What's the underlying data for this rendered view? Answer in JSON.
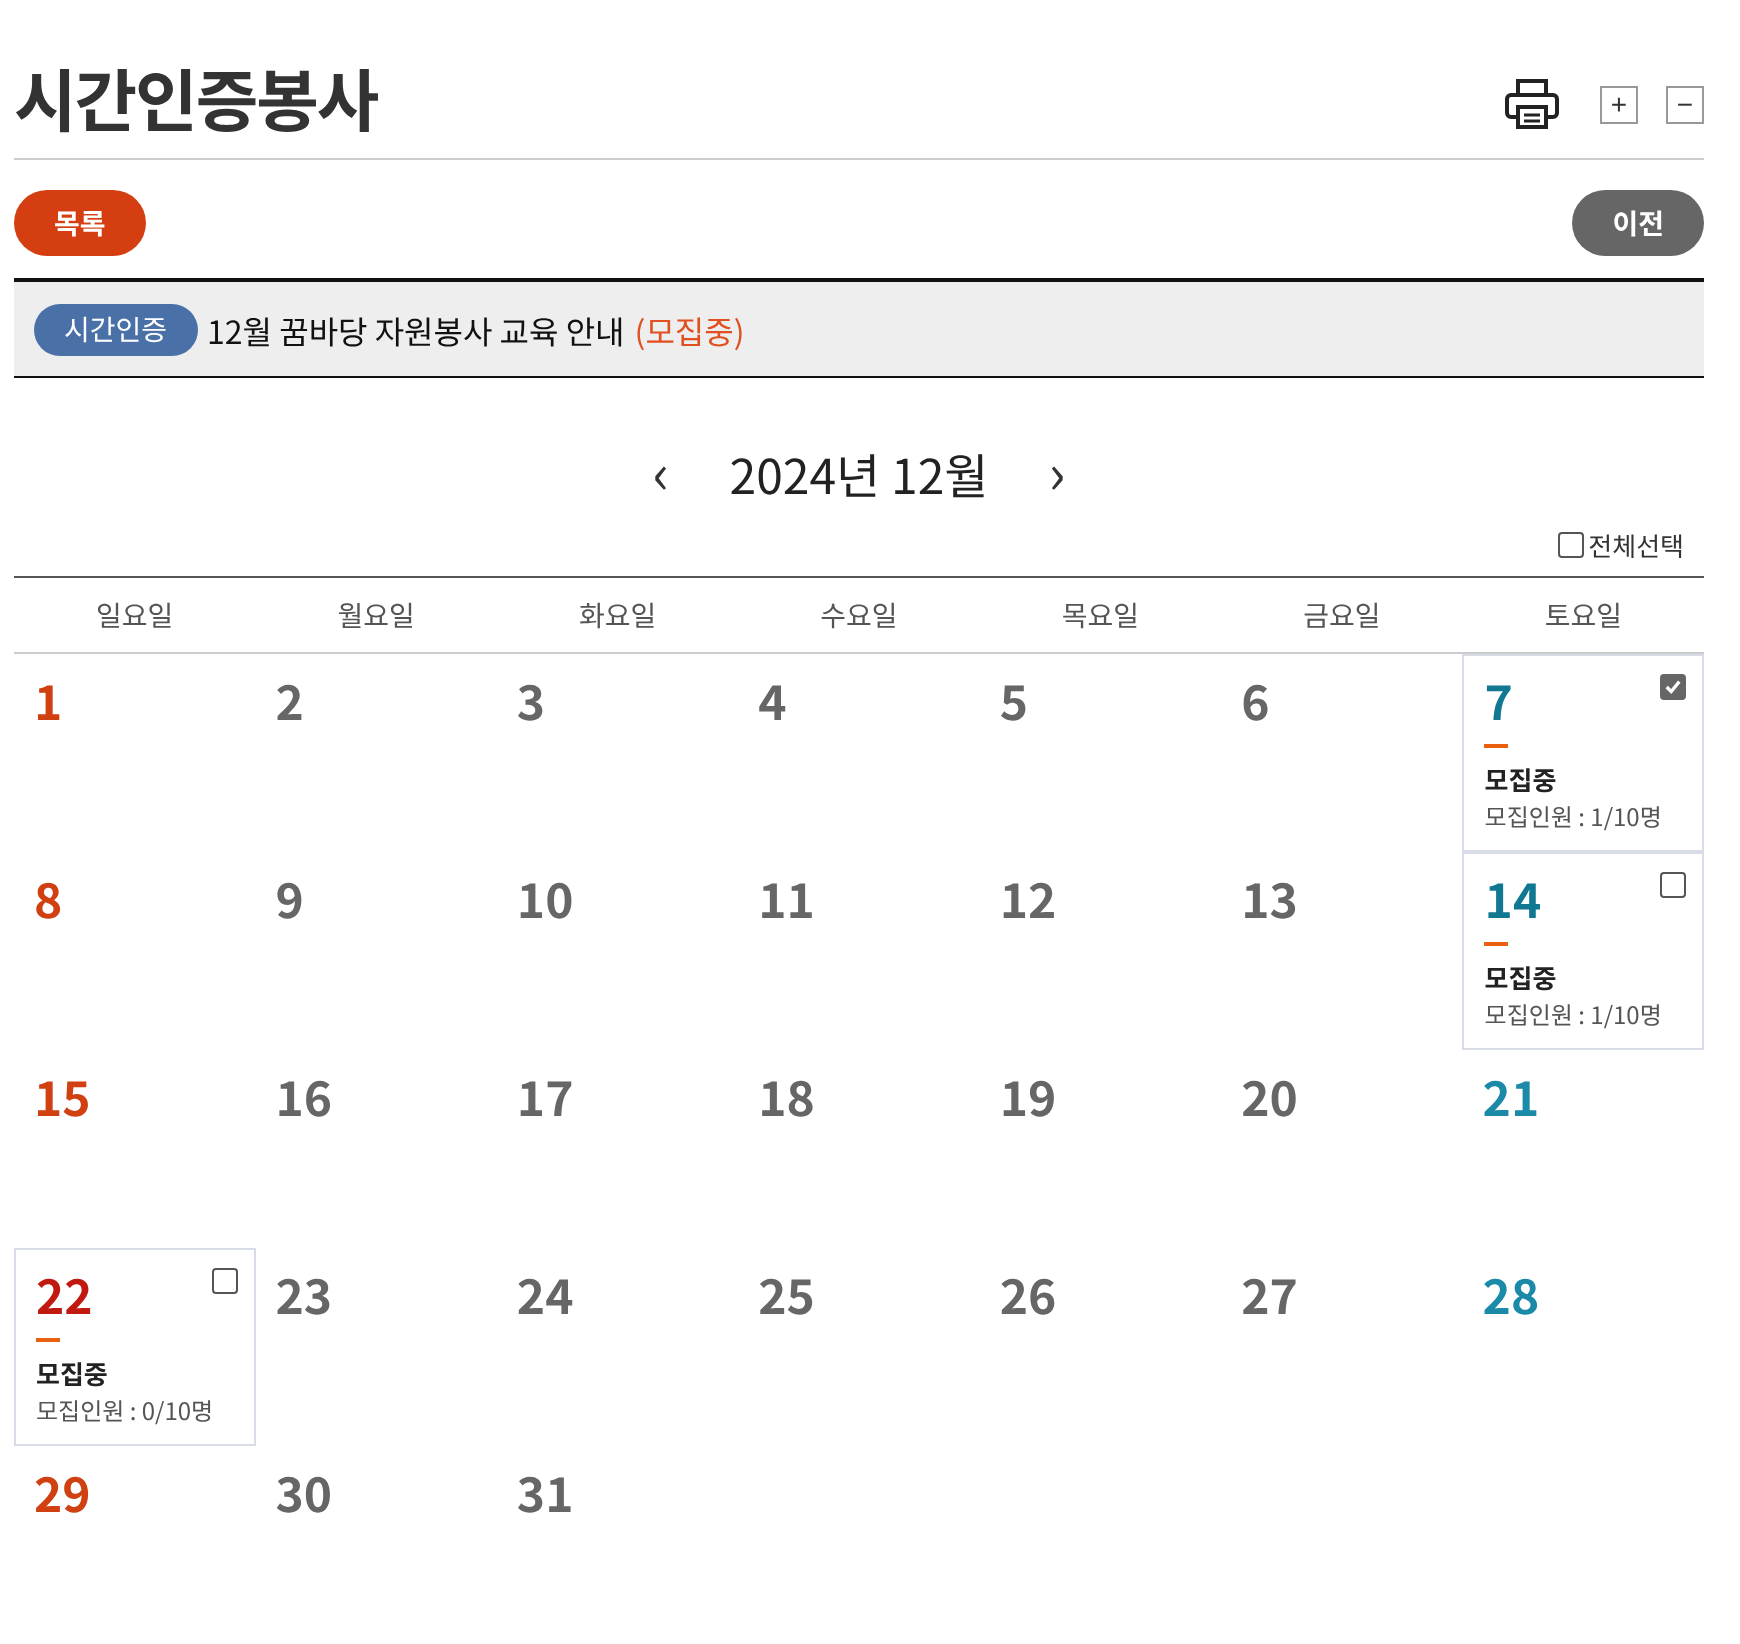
{
  "title": "시간인증봉사",
  "zoom": {
    "plus": "+",
    "minus": "−"
  },
  "buttons": {
    "list": "목록",
    "prev": "이전"
  },
  "notice": {
    "badge": "시간인증",
    "title": "12월 꿈바당 자원봉사 교육 안내",
    "status": "(모집중)"
  },
  "calendar": {
    "month": "2024년 12월",
    "prev": "‹",
    "next": "›",
    "select_all": {
      "label": "전체선택",
      "checked": false
    },
    "weekdays": [
      "일요일",
      "월요일",
      "화요일",
      "수요일",
      "목요일",
      "금요일",
      "토요일"
    ],
    "days": [
      {
        "day": "1"
      },
      {
        "day": "2"
      },
      {
        "day": "3"
      },
      {
        "day": "4"
      },
      {
        "day": "5"
      },
      {
        "day": "6"
      },
      {
        "day": "7",
        "event": {
          "status": "모집중",
          "count": "모집인원 : 1/10명",
          "checked": true
        }
      },
      {
        "day": "8"
      },
      {
        "day": "9"
      },
      {
        "day": "10"
      },
      {
        "day": "11"
      },
      {
        "day": "12"
      },
      {
        "day": "13"
      },
      {
        "day": "14",
        "event": {
          "status": "모집중",
          "count": "모집인원 : 1/10명",
          "checked": false
        }
      },
      {
        "day": "15"
      },
      {
        "day": "16"
      },
      {
        "day": "17"
      },
      {
        "day": "18"
      },
      {
        "day": "19"
      },
      {
        "day": "20"
      },
      {
        "day": "21"
      },
      {
        "day": "22",
        "event": {
          "status": "모집중",
          "count": "모집인원 : 0/10명",
          "checked": false
        }
      },
      {
        "day": "23"
      },
      {
        "day": "24"
      },
      {
        "day": "25"
      },
      {
        "day": "26"
      },
      {
        "day": "27"
      },
      {
        "day": "28"
      },
      {
        "day": "29"
      },
      {
        "day": "30"
      },
      {
        "day": "31"
      }
    ]
  }
}
